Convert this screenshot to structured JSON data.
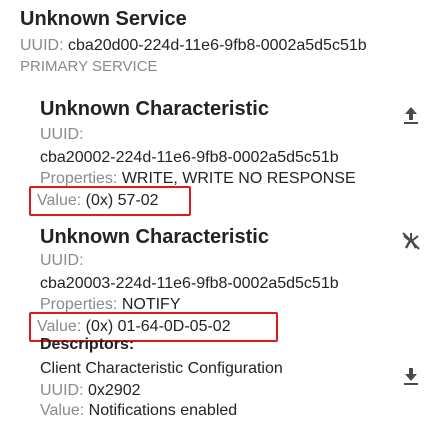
{
  "service": {
    "name": "Unknown Service",
    "uuid_label": "UUID:",
    "uuid": "cba20d00-224d-11e6-9fb8-0002a5d5c51b",
    "type": "PRIMARY SERVICE"
  },
  "characteristics": [
    {
      "name": "Unknown Characteristic",
      "uuid_label": "UUID:",
      "uuid": "cba20002-224d-11e6-9fb8-0002a5d5c51b",
      "properties_label": "Properties:",
      "properties": "WRITE, WRITE NO RESPONSE",
      "value_label": "Value:",
      "value": "(0x) 57-02",
      "action_icon": "upload-arrow-icon"
    },
    {
      "name": "Unknown Characteristic",
      "uuid_label": "UUID:",
      "uuid": "cba20003-224d-11e6-9fb8-0002a5d5c51b",
      "properties_label": "Properties:",
      "properties": "NOTIFY",
      "value_label": "Value:",
      "value": "(0x) 01-64-0D-05-02",
      "action_icon": "notifications-off-icon",
      "descriptors_label": "Descriptors:",
      "descriptor": {
        "name": "Client Characteristic Configuration",
        "uuid_label": "UUID:",
        "uuid": "0x2902",
        "value_label": "Value:",
        "value": "Notifications enabled",
        "action_icon": "download-arrow-icon"
      }
    }
  ],
  "colors": {
    "highlight": "#e01a1a",
    "label": "#8a8a8a",
    "text": "#232323",
    "icon": "#4a4a4a"
  }
}
